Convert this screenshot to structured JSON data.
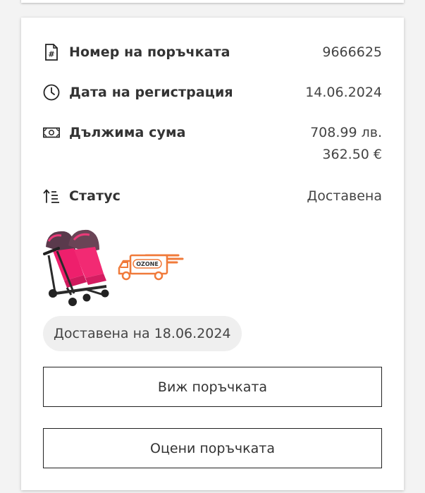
{
  "order": {
    "number_label": "Номер на поръчката",
    "number_value": "9666625",
    "date_label": "Дата на регистрация",
    "date_value": "14.06.2024",
    "amount_label": "Дължима сума",
    "amount_bgn": "708.99 лв.",
    "amount_eur": "362.50 €",
    "status_label": "Статус",
    "status_value": "Доставена",
    "delivered_badge": "Доставена на 18.06.2024",
    "truck_logo_text": "OZONE"
  },
  "actions": {
    "view_order": "Виж поръчката",
    "rate_order": "Оцени поръчката"
  },
  "icons": {
    "number": "receipt-hash-icon",
    "date": "clock-icon",
    "amount": "banknote-icon",
    "status": "sort-status-icon"
  },
  "colors": {
    "truck_orange": "#f07a3a",
    "badge_bg": "#efefef"
  }
}
